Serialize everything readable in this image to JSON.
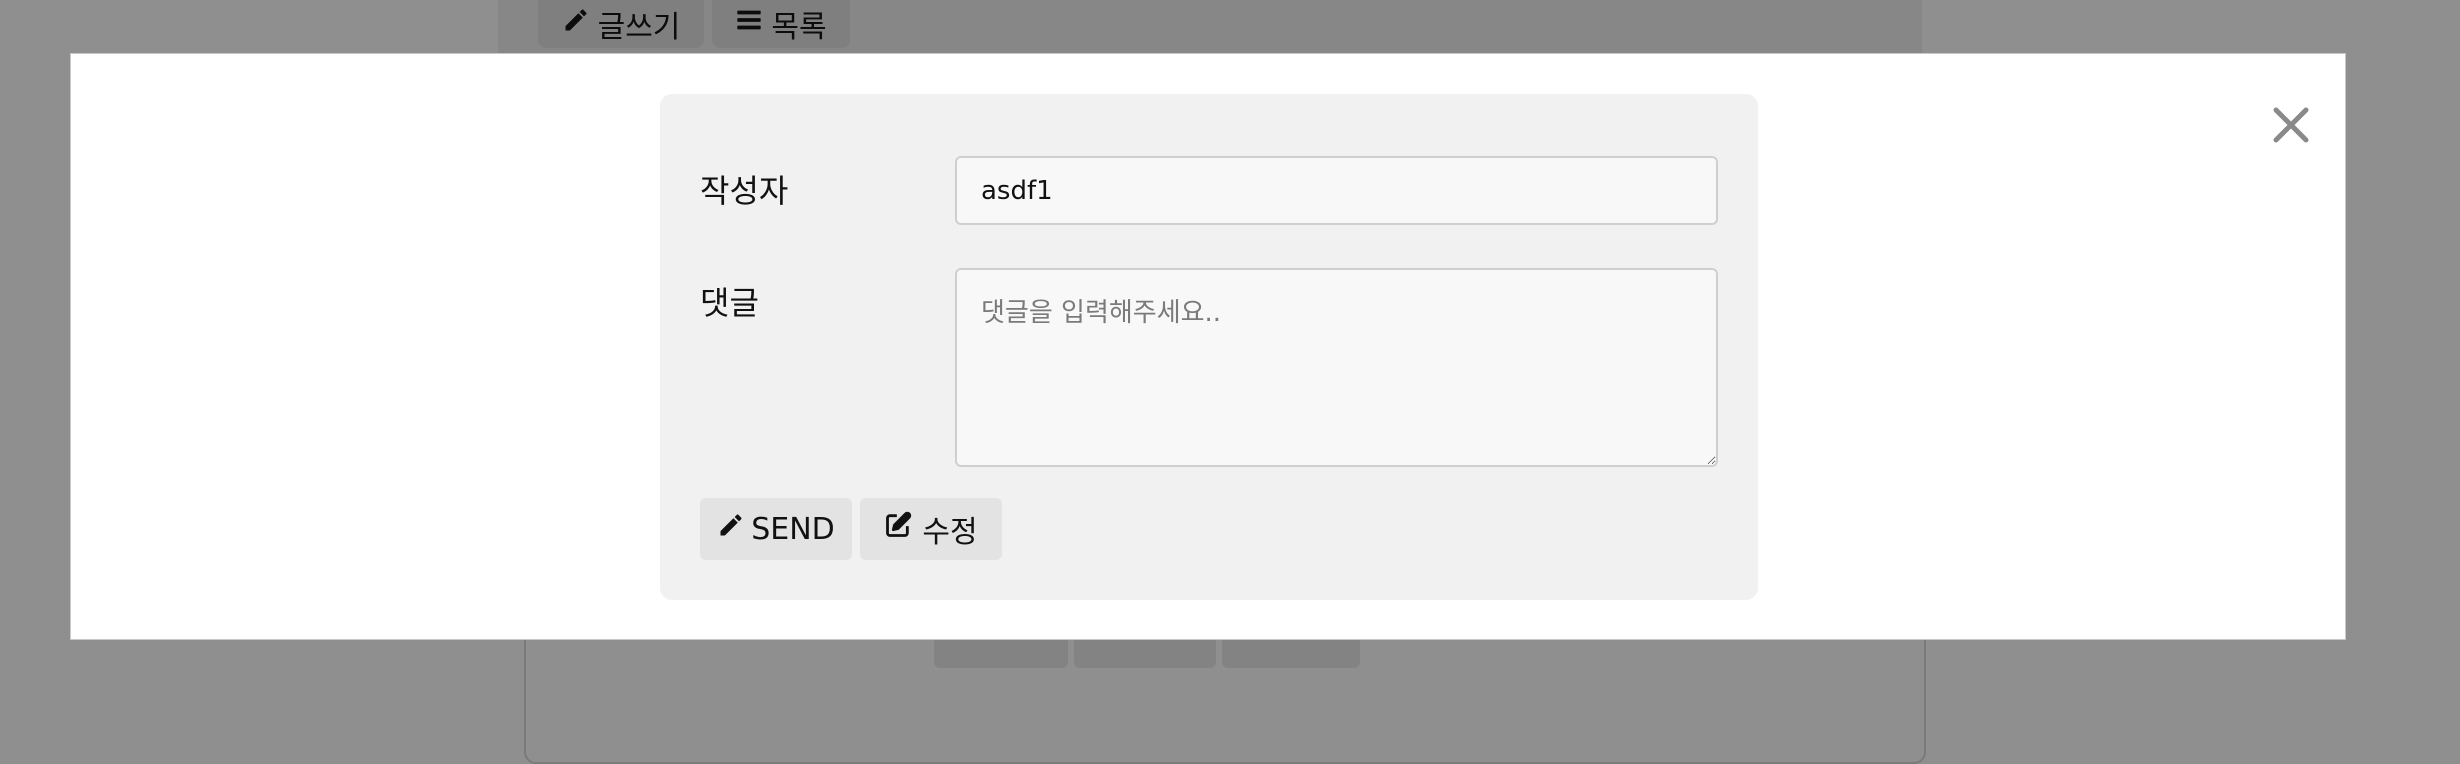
{
  "background": {
    "toolbar": {
      "write_label": "글쓰기",
      "list_label": "목록"
    }
  },
  "modal": {
    "close_icon": "close-icon",
    "form": {
      "author_label": "작성자",
      "author_value": "asdf1",
      "comment_label": "댓글",
      "comment_placeholder": "댓글을 입력해주세요..",
      "comment_value": "",
      "send_label": "SEND",
      "edit_label": "수정"
    }
  },
  "icons": {
    "write": "pencil-icon",
    "list": "list-icon",
    "send": "pencil-icon",
    "edit": "edit-icon"
  }
}
